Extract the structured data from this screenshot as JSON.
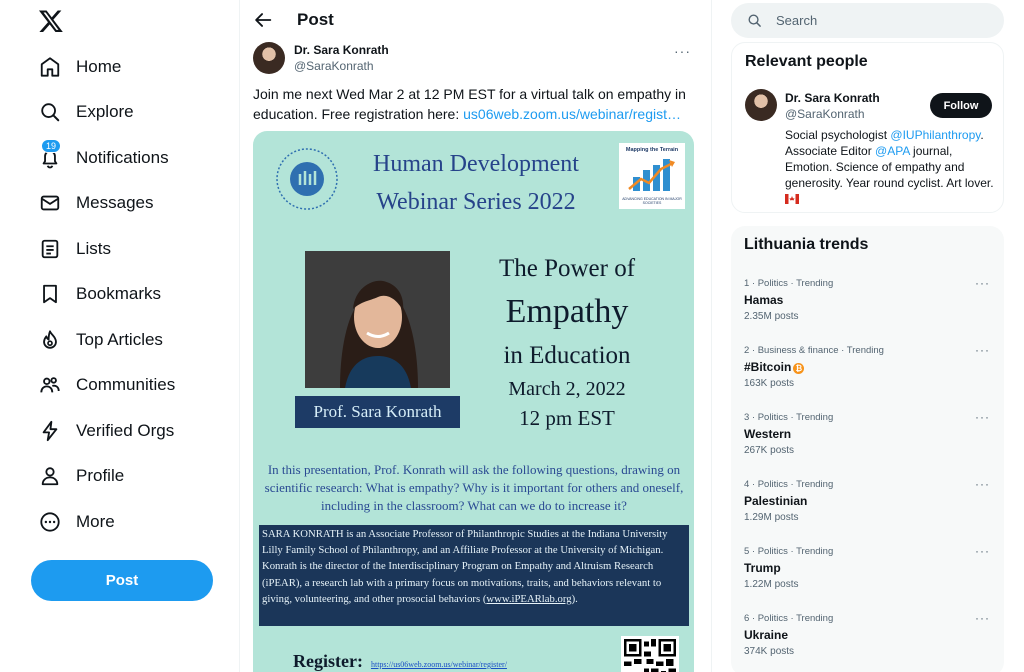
{
  "nav": {
    "items": [
      {
        "label": "Home",
        "icon": "home-icon"
      },
      {
        "label": "Explore",
        "icon": "search-icon"
      },
      {
        "label": "Notifications",
        "icon": "bell-icon",
        "badge": "19"
      },
      {
        "label": "Messages",
        "icon": "envelope-icon"
      },
      {
        "label": "Lists",
        "icon": "list-icon"
      },
      {
        "label": "Bookmarks",
        "icon": "bookmark-icon"
      },
      {
        "label": "Top Articles",
        "icon": "flame-icon"
      },
      {
        "label": "Communities",
        "icon": "communities-icon"
      },
      {
        "label": "Verified Orgs",
        "icon": "lightning-icon"
      },
      {
        "label": "Profile",
        "icon": "person-icon"
      },
      {
        "label": "More",
        "icon": "more-circle-icon"
      }
    ],
    "post_button": "Post"
  },
  "main": {
    "title": "Post",
    "author_name": "Dr. Sara Konrath",
    "author_handle": "@SaraKonrath",
    "more": "···",
    "text": "Join me next Wed Mar 2 at 12 PM EST for a virtual talk on empathy in education. Free registration here: ",
    "link": "us06web.zoom.us/webinar/regist…"
  },
  "flyer": {
    "title_line1": "Human Development",
    "title_line2": "Webinar Series 2022",
    "map_title": "Mapping the Terrain",
    "map_sub": "ADVANCING EDUCATION IN MAJOR SOCIETIES",
    "photo_label": "Prof. Sara Konrath",
    "power_l1": "The Power of",
    "power_l2": "Empathy",
    "power_l3": "in Education",
    "date": "March 2, 2022",
    "time": "12 pm EST",
    "question": "In this presentation, Prof. Konrath will ask the following questions, drawing on scientific research: What is empathy? Why is it important for others and oneself, including in the classroom? What can we do to increase it?",
    "bio_text": "SARA KONRATH is an Associate Professor of Philanthropic Studies at the Indiana University Lilly Family School of Philanthropy, and an Affiliate Professor at the University of Michigan. Konrath is the director of the Interdisciplinary Program on Empathy and Altruism Research (iPEAR), a research lab with a primary focus on motivations, traits, and behaviors relevant to giving, volunteering, and other prosocial behaviors (",
    "bio_link": "www.iPEARlab.org",
    "bio_end": ").",
    "register_label": "Register:",
    "register_url": "https://us06web.zoom.us/webinar/register/"
  },
  "search": {
    "placeholder": "Search"
  },
  "people": {
    "title": "Relevant people",
    "name": "Dr. Sara Konrath",
    "handle": "@SaraKonrath",
    "follow": "Follow",
    "bio_1": "Social psychologist ",
    "bio_m1": "@IUPhilanthropy",
    "bio_2": ". Associate Editor ",
    "bio_m2": "@APA",
    "bio_3": " journal, Emotion. Science of empathy and generosity. Year round cyclist. Art lover. "
  },
  "trends": {
    "title": "Lithuania trends",
    "items": [
      {
        "meta": "1 · Politics · Trending",
        "name": "Hamas",
        "count": "2.35M posts"
      },
      {
        "meta": "2 · Business & finance · Trending",
        "name": "#Bitcoin",
        "count": "163K posts"
      },
      {
        "meta": "3 · Politics · Trending",
        "name": "Western",
        "count": "267K posts"
      },
      {
        "meta": "4 · Politics · Trending",
        "name": "Palestinian",
        "count": "1.29M posts"
      },
      {
        "meta": "5 · Politics · Trending",
        "name": "Trump",
        "count": "1.22M posts"
      },
      {
        "meta": "6 · Politics · Trending",
        "name": "Ukraine",
        "count": "374K posts"
      }
    ],
    "more": "···"
  }
}
